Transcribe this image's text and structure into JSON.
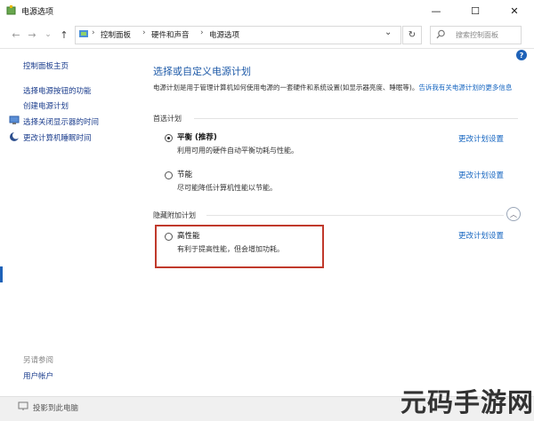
{
  "window": {
    "title": "电源选项",
    "minimize_glyph": "—",
    "maximize_glyph": "☐",
    "close_glyph": "✕"
  },
  "nav": {
    "back_glyph": "←",
    "forward_glyph": "→",
    "recent_glyph": "⌄",
    "up_glyph": "↑",
    "breadcrumbs": [
      "控制面板",
      "硬件和声音",
      "电源选项"
    ],
    "separator": "›",
    "dropdown_glyph": "⌄",
    "refresh_glyph": "↻",
    "search_placeholder": "搜索控制面板"
  },
  "sidebar": {
    "home": "控制面板主页",
    "items": [
      "选择电源按钮的功能",
      "创建电源计划",
      "选择关闭显示器的时间",
      "更改计算机睡眠时间"
    ],
    "see_also_label": "另请参阅",
    "see_also_items": [
      "用户帐户"
    ]
  },
  "main": {
    "title": "选择或自定义电源计划",
    "description": "电源计划是用于管理计算机如何使用电源的一套硬件和系统设置(如显示器亮度、睡眠等)。",
    "description_link": "告诉我有关电源计划的更多信息",
    "help_glyph": "?",
    "preferred_label": "首选计划",
    "hidden_label": "隐藏附加计划",
    "collapse_glyph": "︿",
    "plans": [
      {
        "name": "平衡 (推荐)",
        "desc": "利用可用的硬件自动平衡功耗与性能。",
        "link": "更改计划设置",
        "selected": true
      },
      {
        "name": "节能",
        "desc": "尽可能降低计算机性能以节能。",
        "link": "更改计划设置",
        "selected": false
      },
      {
        "name": "高性能",
        "desc": "有利于提高性能，但会增加功耗。",
        "link": "更改计划设置",
        "selected": false
      }
    ]
  },
  "taskbar": {
    "item": "投影到此电脑"
  },
  "watermark": "元码手游网"
}
